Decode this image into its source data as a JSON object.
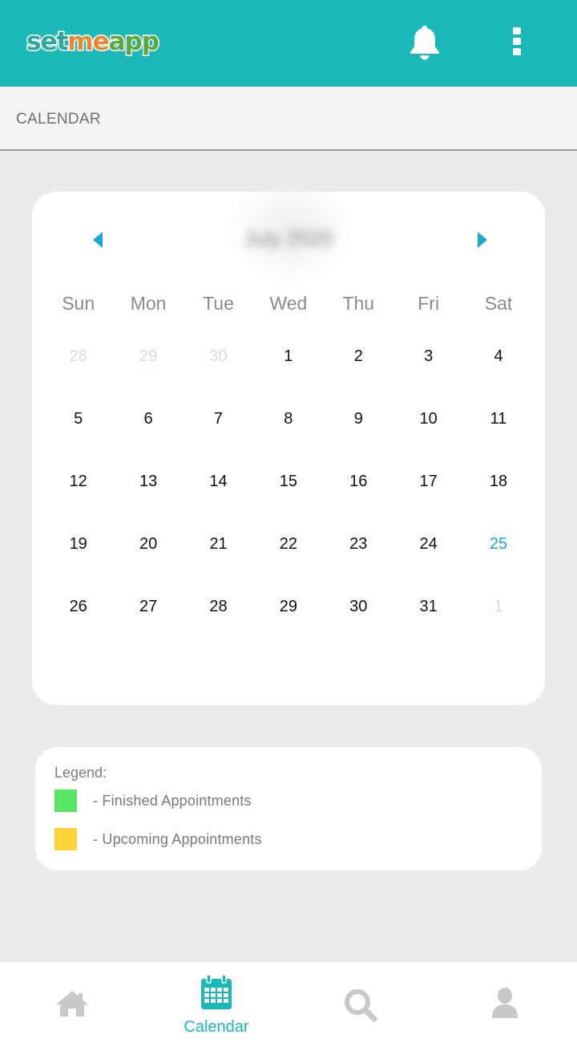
{
  "app": {
    "logo": {
      "part1": "set",
      "part2": "me",
      "part3": "app"
    }
  },
  "colors": {
    "header_bg": "#1bb8b8",
    "accent": "#1ba9c9",
    "finished": "#56e663",
    "upcoming": "#ffd23a",
    "nav_inactive": "#c8c8c8"
  },
  "icons": {
    "notifications": "bell-icon",
    "menu": "more-vert-icon",
    "prev": "triangle-left-icon",
    "next": "triangle-right-icon",
    "home": "home-icon",
    "calendar": "calendar-icon",
    "search": "search-icon",
    "profile": "person-icon"
  },
  "page": {
    "title": "CALENDAR"
  },
  "calendar": {
    "month_label": "July 2020",
    "weekdays": [
      "Sun",
      "Mon",
      "Tue",
      "Wed",
      "Thu",
      "Fri",
      "Sat"
    ],
    "days": [
      {
        "d": "28",
        "muted": true
      },
      {
        "d": "29",
        "muted": true
      },
      {
        "d": "30",
        "muted": true
      },
      {
        "d": "1"
      },
      {
        "d": "2"
      },
      {
        "d": "3"
      },
      {
        "d": "4"
      },
      {
        "d": "5"
      },
      {
        "d": "6"
      },
      {
        "d": "7"
      },
      {
        "d": "8"
      },
      {
        "d": "9"
      },
      {
        "d": "10"
      },
      {
        "d": "11"
      },
      {
        "d": "12"
      },
      {
        "d": "13"
      },
      {
        "d": "14"
      },
      {
        "d": "15"
      },
      {
        "d": "16"
      },
      {
        "d": "17"
      },
      {
        "d": "18"
      },
      {
        "d": "19"
      },
      {
        "d": "20"
      },
      {
        "d": "21"
      },
      {
        "d": "22"
      },
      {
        "d": "23"
      },
      {
        "d": "24"
      },
      {
        "d": "25",
        "today": true
      },
      {
        "d": "26"
      },
      {
        "d": "27"
      },
      {
        "d": "28"
      },
      {
        "d": "29"
      },
      {
        "d": "30"
      },
      {
        "d": "31"
      },
      {
        "d": "1",
        "muted": true
      }
    ]
  },
  "legend": {
    "title": "Legend:",
    "items": [
      {
        "label": "- Finished Appointments",
        "color": "#56e663"
      },
      {
        "label": "- Upcoming Appointments",
        "color": "#ffd23a"
      }
    ]
  },
  "bottom_nav": {
    "active": "calendar",
    "calendar_label": "Calendar"
  }
}
